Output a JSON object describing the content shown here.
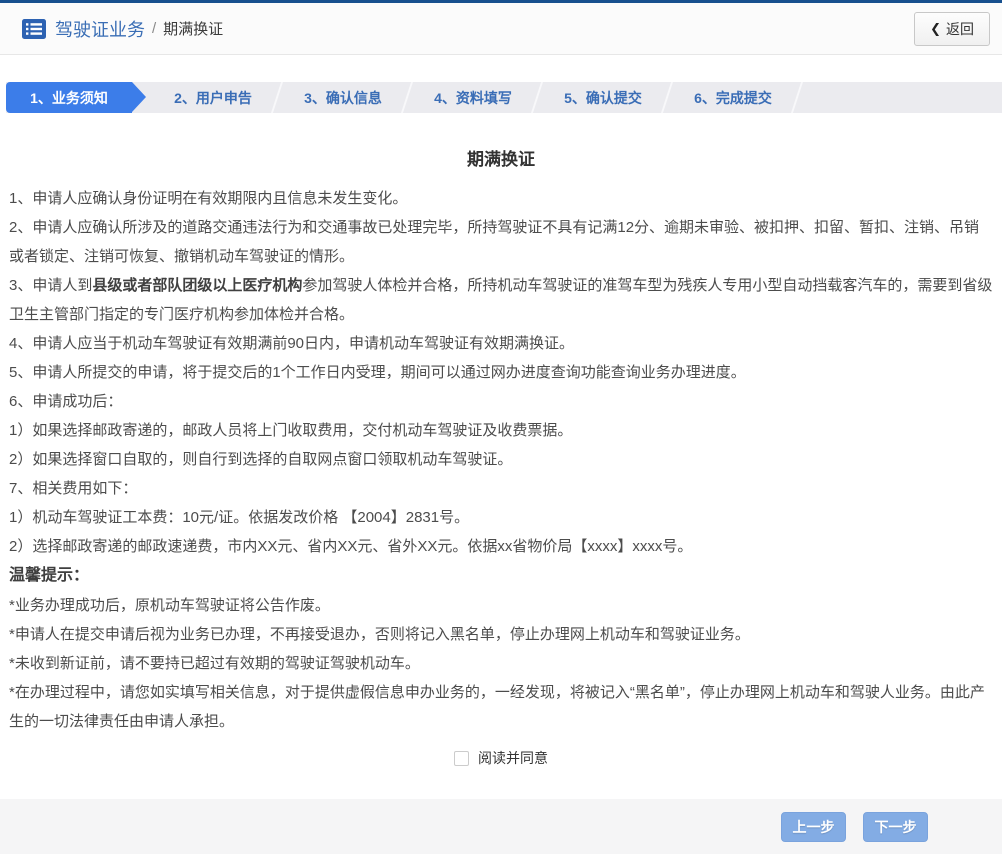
{
  "header": {
    "section_title": "驾驶证业务",
    "separator": "/",
    "current_page": "期满换证",
    "back_chevron": "❮",
    "back_label": "返回"
  },
  "steps": [
    {
      "label": "1、业务须知",
      "active": true
    },
    {
      "label": "2、用户申告",
      "active": false
    },
    {
      "label": "3、确认信息",
      "active": false
    },
    {
      "label": "4、资料填写",
      "active": false
    },
    {
      "label": "5、确认提交",
      "active": false
    },
    {
      "label": "6、完成提交",
      "active": false
    }
  ],
  "content": {
    "title": "期满换证",
    "paragraphs": {
      "p1": "1、申请人应确认身份证明在有效期限内且信息未发生变化。",
      "p2": "2、申请人应确认所涉及的道路交通违法行为和交通事故已处理完毕，所持驾驶证不具有记满12分、逾期未审验、被扣押、扣留、暂扣、注销、吊销或者锁定、注销可恢复、撤销机动车驾驶证的情形。",
      "p3_pre": "3、申请人到",
      "p3_bold": "县级或者部队团级以上医疗机构",
      "p3_post": "参加驾驶人体检并合格，所持机动车驾驶证的准驾车型为残疾人专用小型自动挡载客汽车的，需要到省级卫生主管部门指定的专门医疗机构参加体检并合格。",
      "p4": "4、申请人应当于机动车驾驶证有效期满前90日内，申请机动车驾驶证有效期满换证。",
      "p5": "5、申请人所提交的申请，将于提交后的1个工作日内受理，期间可以通过网办进度查询功能查询业务办理进度。",
      "p6": "6、申请成功后：",
      "p6_1": "1）如果选择邮政寄递的，邮政人员将上门收取费用，交付机动车驾驶证及收费票据。",
      "p6_2": "2）如果选择窗口自取的，则自行到选择的自取网点窗口领取机动车驾驶证。",
      "p7": "7、相关费用如下：",
      "p7_1": "1）机动车驾驶证工本费：10元/证。依据发改价格 【2004】2831号。",
      "p7_2": "2）选择邮政寄递的邮政速递费，市内XX元、省内XX元、省外XX元。依据xx省物价局【xxxx】xxxx号。"
    },
    "tips": {
      "title": "温馨提示：",
      "t1": "*业务办理成功后，原机动车驾驶证将公告作废。",
      "t2": "*申请人在提交申请后视为业务已办理，不再接受退办，否则将记入黑名单，停止办理网上机动车和驾驶证业务。",
      "t3": "*未收到新证前，请不要持已超过有效期的驾驶证驾驶机动车。",
      "t4": "*在办理过程中，请您如实填写相关信息，对于提供虚假信息申办业务的，一经发现，将被记入“黑名单”，停止办理网上机动车和驾驶人业务。由此产生的一切法律责任由申请人承担。"
    }
  },
  "agreement": {
    "label": "阅读并同意",
    "checked": false
  },
  "footer": {
    "prev_label": "上一步",
    "next_label": "下一步"
  },
  "colors": {
    "top_border": "#17508e",
    "accent_blue": "#3a6eb5",
    "step_active_bg": "#3c7de9",
    "step_inactive_bg": "#ebebef",
    "action_button_bg": "#83ace4",
    "footer_bg": "#f5f5f6"
  }
}
